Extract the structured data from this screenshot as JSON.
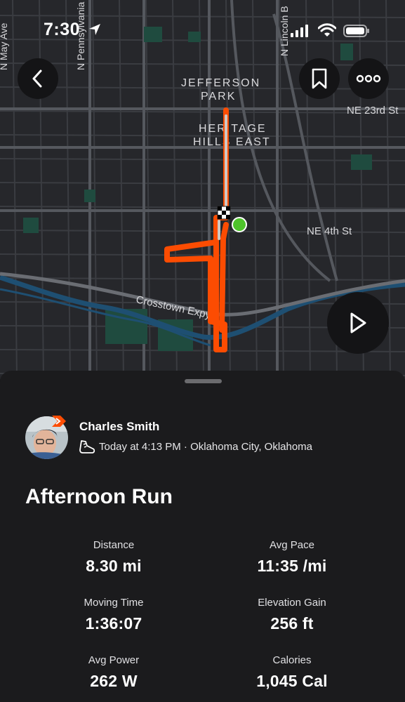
{
  "status_bar": {
    "time": "7:30"
  },
  "map": {
    "labels": {
      "jefferson_line1": "JEFFERSON",
      "jefferson_line2": "PARK",
      "heritage_line1": "HERITAGE",
      "heritage_line2": "HILLS EAST",
      "ne23": "NE 23rd St",
      "ne4": "NE 4th St",
      "crosstown": "Crosstown Expy",
      "n_penn": "N Pennsylvania",
      "n_lincoln": "N Lincoln B",
      "n_may": "N May Ave"
    },
    "route_color": "#fc4c02"
  },
  "athlete": {
    "name": "Charles Smith",
    "meta": "Today at 4:13 PM · Oklahoma City, Oklahoma"
  },
  "activity": {
    "title": "Afternoon Run",
    "stats": [
      {
        "label": "Distance",
        "value": "8.30 mi"
      },
      {
        "label": "Avg Pace",
        "value": "11:35 /mi"
      },
      {
        "label": "Moving Time",
        "value": "1:36:07"
      },
      {
        "label": "Elevation Gain",
        "value": "256 ft"
      },
      {
        "label": "Avg Power",
        "value": "262 W"
      },
      {
        "label": "Calories",
        "value": "1,045 Cal"
      }
    ]
  },
  "icons": {
    "back": "chevron-left-icon",
    "bookmark": "bookmark-icon",
    "more": "ellipsis-icon",
    "play": "play-icon",
    "shoe": "shoe-icon"
  },
  "colors": {
    "accent": "#fc4c02",
    "start_marker": "#4ec32b"
  }
}
